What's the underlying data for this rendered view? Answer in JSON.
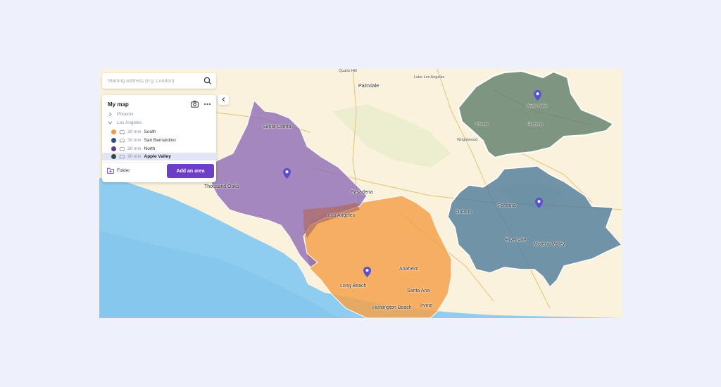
{
  "search": {
    "placeholder": "Starting address (e.g. London)",
    "icon": "search-icon"
  },
  "panel": {
    "title": "My map",
    "groups": [
      {
        "label": "Phoenix",
        "expanded": false
      },
      {
        "label": "Los Angeles",
        "expanded": true
      }
    ],
    "areas": [
      {
        "duration": "30 min",
        "name": "South",
        "color": "#f29a3a",
        "selected": false
      },
      {
        "duration": "30 min",
        "name": "San Bernardino",
        "color": "#2d4a8c",
        "selected": false
      },
      {
        "duration": "30 min",
        "name": "North",
        "color": "#5b3f8c",
        "selected": false
      },
      {
        "duration": "30 min",
        "name": "Apple Valley",
        "color": "#2f4b3c",
        "selected": true
      }
    ],
    "folder_label": "Folder",
    "add_area_label": "Add an area"
  },
  "map": {
    "labels": {
      "palmdale": "Palmdale",
      "lake_los_angeles": "Lake Los Angeles",
      "quartz_hill": "Quartz Hill",
      "apple_valley": "Apple Valley",
      "hesperia": "Hesperia",
      "phelan": "Phelan",
      "wrightwood": "Wrightwood",
      "santa_clarita": "Santa Clarita",
      "thousand_oaks": "Thousand Oaks",
      "pasadena": "Pasadena",
      "los_angeles": "Los Angeles",
      "ontario": "Ontario",
      "fontana": "Fontana",
      "riverside": "Riverside",
      "moreno_valley": "Moreno Valley",
      "anaheim": "Anaheim",
      "long_beach": "Long Beach",
      "santa_ana": "Santa Ana",
      "huntington_beach": "Huntington Beach",
      "irvine": "Irvine"
    },
    "colors": {
      "land": "#faf2dc",
      "ocean": "#8fcdf0",
      "purple_area": "#8e6bb4",
      "orange_area": "#f5a24e",
      "blue_area": "#4f7a9a",
      "green_area": "#5f7d6c",
      "pin": "#5a4fcf"
    }
  }
}
